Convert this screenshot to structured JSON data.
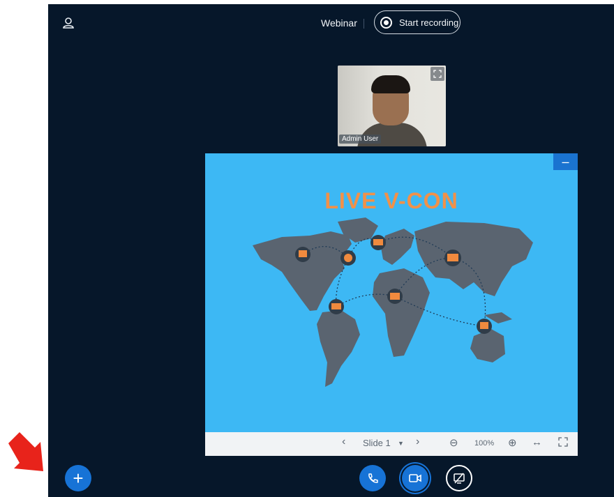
{
  "header": {
    "mode_label": "Webinar",
    "record_label": "Start recording"
  },
  "webcam": {
    "user_name": "Admin User"
  },
  "presentation": {
    "slide_title": "LIVE V-CON",
    "toolbar": {
      "slide_label": "Slide 1",
      "zoom": "100%"
    }
  },
  "colors": {
    "background": "#06172a",
    "accent": "#1773d6",
    "slide_bg": "#3db8f4",
    "title_orange": "#f19149",
    "annotation_arrow": "#e8231b"
  }
}
